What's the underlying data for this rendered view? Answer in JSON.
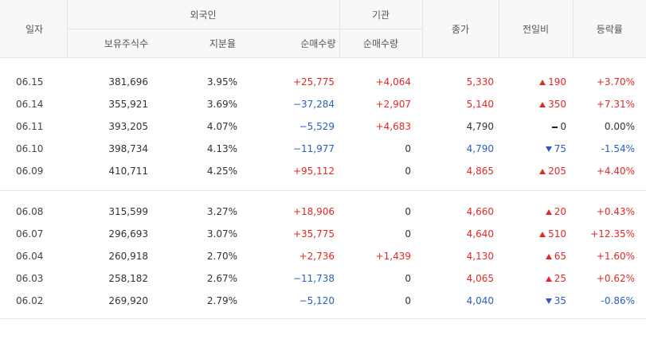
{
  "header": {
    "date": "일자",
    "foreign_group": "외국인",
    "institution_group": "기관",
    "close": "종가",
    "change": "전일비",
    "rate": "등락률",
    "foreign_holdings": "보유주식수",
    "foreign_ratio": "지분율",
    "foreign_net": "순매수량",
    "institution_net": "순매수량"
  },
  "groups": [
    {
      "rows": [
        {
          "date": "06.15",
          "holdings": "381,696",
          "ratio": "3.95%",
          "foreign_net": "+25,775",
          "foreign_dir": "up",
          "inst_net": "+4,064",
          "inst_dir": "up",
          "close": "5,330",
          "close_dir": "up",
          "change": "190",
          "change_dir": "up",
          "change_icon": "triangle-up-icon",
          "rate": "+3.70%",
          "rate_dir": "up"
        },
        {
          "date": "06.14",
          "holdings": "355,921",
          "ratio": "3.69%",
          "foreign_net": "−37,284",
          "foreign_dir": "dn",
          "inst_net": "+2,907",
          "inst_dir": "up",
          "close": "5,140",
          "close_dir": "up",
          "change": "350",
          "change_dir": "up",
          "change_icon": "triangle-up-icon",
          "rate": "+7.31%",
          "rate_dir": "up"
        },
        {
          "date": "06.11",
          "holdings": "393,205",
          "ratio": "4.07%",
          "foreign_net": "−5,529",
          "foreign_dir": "dn",
          "inst_net": "+4,683",
          "inst_dir": "up",
          "close": "4,790",
          "close_dir": "nt",
          "change": "0",
          "change_dir": "nt",
          "change_icon": "dash-icon",
          "rate": "0.00%",
          "rate_dir": "nt"
        },
        {
          "date": "06.10",
          "holdings": "398,734",
          "ratio": "4.13%",
          "foreign_net": "−11,977",
          "foreign_dir": "dn",
          "inst_net": "0",
          "inst_dir": "nt",
          "close": "4,790",
          "close_dir": "dn",
          "change": "75",
          "change_dir": "dn",
          "change_icon": "triangle-down-icon",
          "rate": "-1.54%",
          "rate_dir": "dn"
        },
        {
          "date": "06.09",
          "holdings": "410,711",
          "ratio": "4.25%",
          "foreign_net": "+95,112",
          "foreign_dir": "up",
          "inst_net": "0",
          "inst_dir": "nt",
          "close": "4,865",
          "close_dir": "up",
          "change": "205",
          "change_dir": "up",
          "change_icon": "triangle-up-icon",
          "rate": "+4.40%",
          "rate_dir": "up"
        }
      ]
    },
    {
      "rows": [
        {
          "date": "06.08",
          "holdings": "315,599",
          "ratio": "3.27%",
          "foreign_net": "+18,906",
          "foreign_dir": "up",
          "inst_net": "0",
          "inst_dir": "nt",
          "close": "4,660",
          "close_dir": "up",
          "change": "20",
          "change_dir": "up",
          "change_icon": "triangle-up-icon",
          "rate": "+0.43%",
          "rate_dir": "up"
        },
        {
          "date": "06.07",
          "holdings": "296,693",
          "ratio": "3.07%",
          "foreign_net": "+35,775",
          "foreign_dir": "up",
          "inst_net": "0",
          "inst_dir": "nt",
          "close": "4,640",
          "close_dir": "up",
          "change": "510",
          "change_dir": "up",
          "change_icon": "triangle-up-icon",
          "rate": "+12.35%",
          "rate_dir": "up"
        },
        {
          "date": "06.04",
          "holdings": "260,918",
          "ratio": "2.70%",
          "foreign_net": "+2,736",
          "foreign_dir": "up",
          "inst_net": "+1,439",
          "inst_dir": "up",
          "close": "4,130",
          "close_dir": "up",
          "change": "65",
          "change_dir": "up",
          "change_icon": "triangle-up-icon",
          "rate": "+1.60%",
          "rate_dir": "up"
        },
        {
          "date": "06.03",
          "holdings": "258,182",
          "ratio": "2.67%",
          "foreign_net": "−11,738",
          "foreign_dir": "dn",
          "inst_net": "0",
          "inst_dir": "nt",
          "close": "4,065",
          "close_dir": "up",
          "change": "25",
          "change_dir": "up",
          "change_icon": "triangle-up-icon",
          "rate": "+0.62%",
          "rate_dir": "up"
        },
        {
          "date": "06.02",
          "holdings": "269,920",
          "ratio": "2.79%",
          "foreign_net": "−5,120",
          "foreign_dir": "dn",
          "inst_net": "0",
          "inst_dir": "nt",
          "close": "4,040",
          "close_dir": "dn",
          "change": "35",
          "change_dir": "dn",
          "change_icon": "triangle-down-icon",
          "rate": "-0.86%",
          "rate_dir": "dn"
        }
      ]
    }
  ],
  "colors": {
    "up": "#e22929",
    "down": "#2b5fbd",
    "neutral": "#333333",
    "header_bg": "#f7f8fa",
    "border": "#e5e5e5"
  }
}
